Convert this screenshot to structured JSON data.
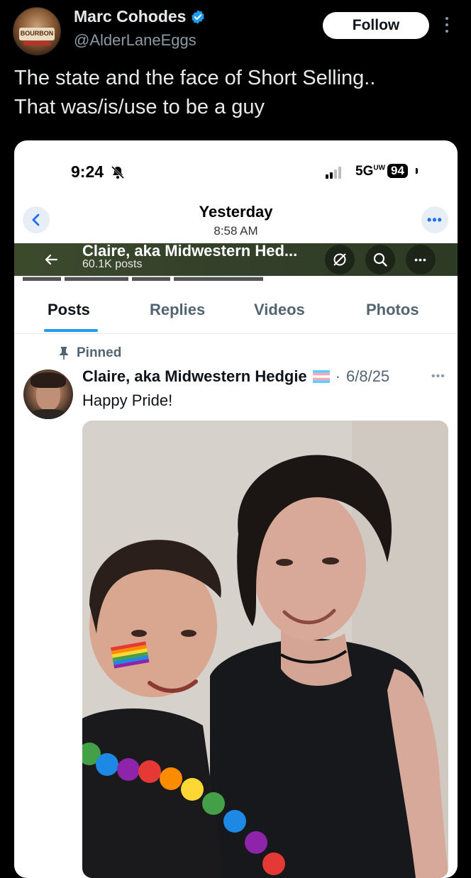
{
  "tweet": {
    "author_name": "Marc Cohodes",
    "author_handle": "@AlderLaneEggs",
    "follow_label": "Follow",
    "text_line1": "The state and the face of Short Selling..",
    "text_line2": "That was/is/use to be a guy",
    "avatar_label": "BOURBON"
  },
  "embedded": {
    "status_bar": {
      "time": "9:24",
      "network": "5G",
      "network_superscript": "UW",
      "battery": "94"
    },
    "messages_header": {
      "date": "Yesterday",
      "time": "8:58 AM"
    },
    "profile_bar": {
      "name": "Claire, aka Midwestern Hed...",
      "posts": "60.1K posts"
    },
    "tabs": [
      {
        "label": "Posts",
        "active": true
      },
      {
        "label": "Replies",
        "active": false
      },
      {
        "label": "Videos",
        "active": false
      },
      {
        "label": "Photos",
        "active": false
      }
    ],
    "post": {
      "pinned_label": "Pinned",
      "author": "Claire, aka Midwestern Hedgie",
      "date": "6/8/25",
      "separator": "·",
      "text": "Happy Pride!"
    }
  },
  "colors": {
    "accent_blue": "#1d9bf0",
    "verified_blue": "#1d9bf0",
    "profile_bar_green": "#3c4a2c"
  }
}
